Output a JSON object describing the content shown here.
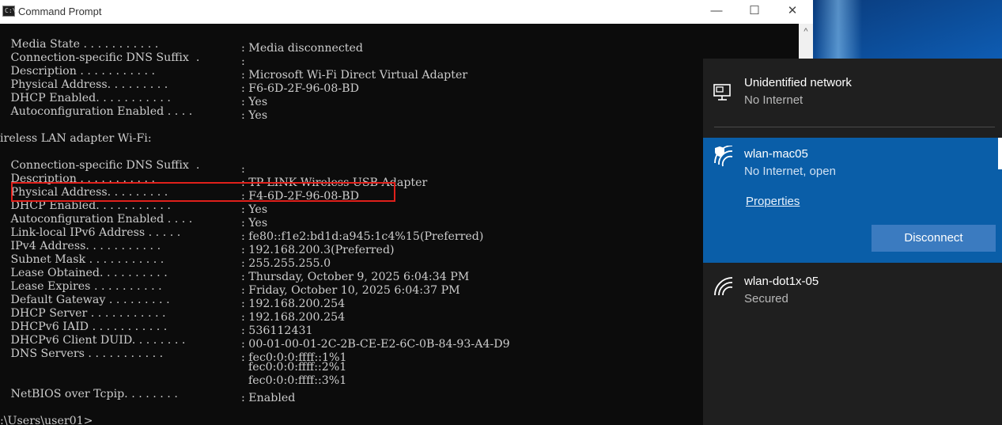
{
  "window": {
    "title": "Command Prompt",
    "icon_text": "C:\\.",
    "minimize_glyph": "—",
    "maximize_glyph": "☐",
    "close_glyph": "✕",
    "scroll_up_glyph": "^"
  },
  "console": {
    "lines": [
      {
        "label": "   Media State . . . . . . . . . . . ",
        "sep": ": ",
        "value": "Media disconnected"
      },
      {
        "label": "   Connection-specific DNS Suffix  . ",
        "sep": ": ",
        "value": ""
      },
      {
        "label": "   Description . . . . . . . . . . . ",
        "sep": ": ",
        "value": "Microsoft Wi-Fi Direct Virtual Adapter"
      },
      {
        "label": "   Physical Address. . . . . . . . . ",
        "sep": ": ",
        "value": "F6-6D-2F-96-08-BD"
      },
      {
        "label": "   DHCP Enabled. . . . . . . . . . . ",
        "sep": ": ",
        "value": "Yes"
      },
      {
        "label": "   Autoconfiguration Enabled . . . . ",
        "sep": ": ",
        "value": "Yes"
      },
      {
        "text": ""
      },
      {
        "text": "ireless LAN adapter Wi-Fi:"
      },
      {
        "text": ""
      },
      {
        "label": "   Connection-specific DNS Suffix  . ",
        "sep": ": ",
        "value": ""
      },
      {
        "label": "   Description . . . . . . . . . . . ",
        "sep": ": ",
        "value": "TP-LINK Wireless USB Adapter"
      },
      {
        "label": "   Physical Address. . . . . . . . . ",
        "sep": ": ",
        "value": "F4-6D-2F-96-08-BD"
      },
      {
        "label": "   DHCP Enabled. . . . . . . . . . . ",
        "sep": ": ",
        "value": "Yes"
      },
      {
        "label": "   Autoconfiguration Enabled . . . . ",
        "sep": ": ",
        "value": "Yes"
      },
      {
        "label": "   Link-local IPv6 Address . . . . . ",
        "sep": ": ",
        "value": "fe80::f1e2:bd1d:a945:1c4%15(Preferred)"
      },
      {
        "label": "   IPv4 Address. . . . . . . . . . . ",
        "sep": ": ",
        "value": "192.168.200.3(Preferred)"
      },
      {
        "label": "   Subnet Mask . . . . . . . . . . . ",
        "sep": ": ",
        "value": "255.255.255.0"
      },
      {
        "label": "   Lease Obtained. . . . . . . . . . ",
        "sep": ": ",
        "value": "Thursday, October 9, 2025 6:04:34 PM"
      },
      {
        "label": "   Lease Expires . . . . . . . . . . ",
        "sep": ": ",
        "value": "Friday, October 10, 2025 6:04:37 PM"
      },
      {
        "label": "   Default Gateway . . . . . . . . . ",
        "sep": ": ",
        "value": "192.168.200.254"
      },
      {
        "label": "   DHCP Server . . . . . . . . . . . ",
        "sep": ": ",
        "value": "192.168.200.254"
      },
      {
        "label": "   DHCPv6 IAID . . . . . . . . . . . ",
        "sep": ": ",
        "value": "536112431"
      },
      {
        "label": "   DHCPv6 Client DUID. . . . . . . . ",
        "sep": ": ",
        "value": "00-01-00-01-2C-2B-CE-E2-6C-0B-84-93-A4-D9"
      },
      {
        "label": "   DNS Servers . . . . . . . . . . . ",
        "sep": ": ",
        "value": "fec0:0:0:ffff::1%1"
      },
      {
        "label": "",
        "sep": "  ",
        "value": "fec0:0:0:ffff::2%1"
      },
      {
        "label": "",
        "sep": "  ",
        "value": "fec0:0:0:ffff::3%1"
      },
      {
        "label": "   NetBIOS over Tcpip. . . . . . . . ",
        "sep": ": ",
        "value": "Enabled"
      },
      {
        "text": ""
      },
      {
        "text": ":\\Users\\user01>"
      }
    ]
  },
  "flyout": {
    "networks": [
      {
        "name": "Unidentified network",
        "status": "No Internet",
        "icon": "ethernet-icon"
      },
      {
        "name": "wlan-mac05",
        "status": "No Internet, open",
        "icon": "wifi-shield-icon",
        "selected": true,
        "properties_label": "Properties",
        "disconnect_label": "Disconnect"
      },
      {
        "name": "wlan-dot1x-05",
        "status": "Secured",
        "icon": "wifi-icon"
      }
    ]
  },
  "colors": {
    "console_bg": "#0c0c0c",
    "console_text": "#cccccc",
    "highlight_box": "#e0201b",
    "flyout_bg": "#1f1f1f",
    "selected_network_bg": "#0a5ea8",
    "disconnect_button": "#3b7bc0"
  }
}
